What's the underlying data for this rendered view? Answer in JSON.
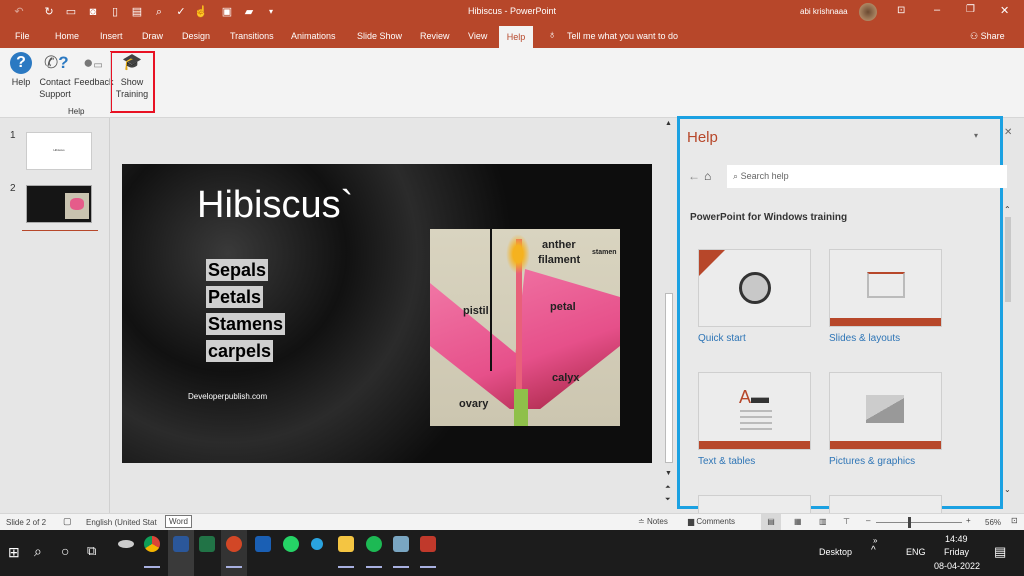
{
  "window": {
    "title": "Hibiscus - PowerPoint",
    "user": "abi krishnaaa"
  },
  "quick_access": [
    "undo-icon",
    "redo-icon",
    "present-icon",
    "camera-icon",
    "new-icon",
    "clipboard-icon",
    "print-preview-icon",
    "spelling-icon",
    "touch-mode-icon",
    "save-icon",
    "open-icon",
    "customize-icon"
  ],
  "tabs": [
    "File",
    "Home",
    "Insert",
    "Draw",
    "Design",
    "Transitions",
    "Animations",
    "Slide Show",
    "Review",
    "View",
    "Help"
  ],
  "active_tab": "Help",
  "tell_me": "Tell me what you want to do",
  "share": "Share",
  "ribbon": {
    "help": "Help",
    "contact_support_1": "Contact",
    "contact_support_2": "Support",
    "feedback": "Feedback",
    "show_training_1": "Show",
    "show_training_2": "Training",
    "group_label": "Help"
  },
  "slides": [
    {
      "number": "1",
      "thumb_text": "Hibiscus"
    },
    {
      "number": "2"
    }
  ],
  "slide": {
    "title": "Hibiscus`",
    "bullets": [
      "Sepals",
      "Petals",
      "Stamens",
      "carpels"
    ],
    "footer": "Developerpublish.com",
    "diagram_labels": {
      "anther": "anther",
      "filament": "filament",
      "stamen": "stamen",
      "pistil": "pistil",
      "petal": "petal",
      "calyx": "calyx",
      "ovary": "ovary"
    }
  },
  "help_pane": {
    "title": "Help",
    "search_placeholder": "Search help",
    "section": "PowerPoint for Windows training",
    "cards": [
      {
        "label": "Quick start"
      },
      {
        "label": "Slides & layouts"
      },
      {
        "label": "Text & tables"
      },
      {
        "label": "Pictures & graphics"
      }
    ]
  },
  "status": {
    "slide": "Slide 2 of 2",
    "language": "English (United Stat",
    "tooltip": "Word",
    "notes": "Notes",
    "comments": "Comments",
    "zoom": "56%"
  },
  "taskbar": {
    "desktop": "Desktop",
    "lang": "ENG",
    "time": "14:49",
    "day": "Friday",
    "date": "08-04-2022"
  },
  "colors": {
    "accent": "#b7472a",
    "highlight_box": "#e81123",
    "help_border": "#1ba1e2",
    "link": "#2e75b6"
  }
}
